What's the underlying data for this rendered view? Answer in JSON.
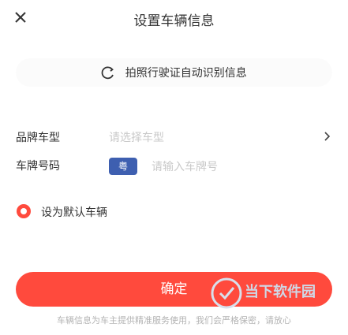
{
  "header": {
    "title": "设置车辆信息"
  },
  "scan": {
    "label": "拍照行驶证自动识别信息",
    "icon": "scan-icon"
  },
  "form": {
    "car_type": {
      "label": "品牌车型",
      "placeholder": "请选择车型"
    },
    "plate": {
      "label": "车牌号码",
      "prefix": "粤",
      "placeholder": "请输入车牌号"
    },
    "agree": {
      "label": "设为默认车辆"
    }
  },
  "actions": {
    "confirm_label": "确定"
  },
  "footer": {
    "note": "车辆信息为车主提供精准服务使用，我们会严格保密，请放心"
  },
  "colors": {
    "accent": "#ff4a3d",
    "plate_blue": "#3e5fb0"
  },
  "watermark": {
    "text": "当下软件园"
  }
}
